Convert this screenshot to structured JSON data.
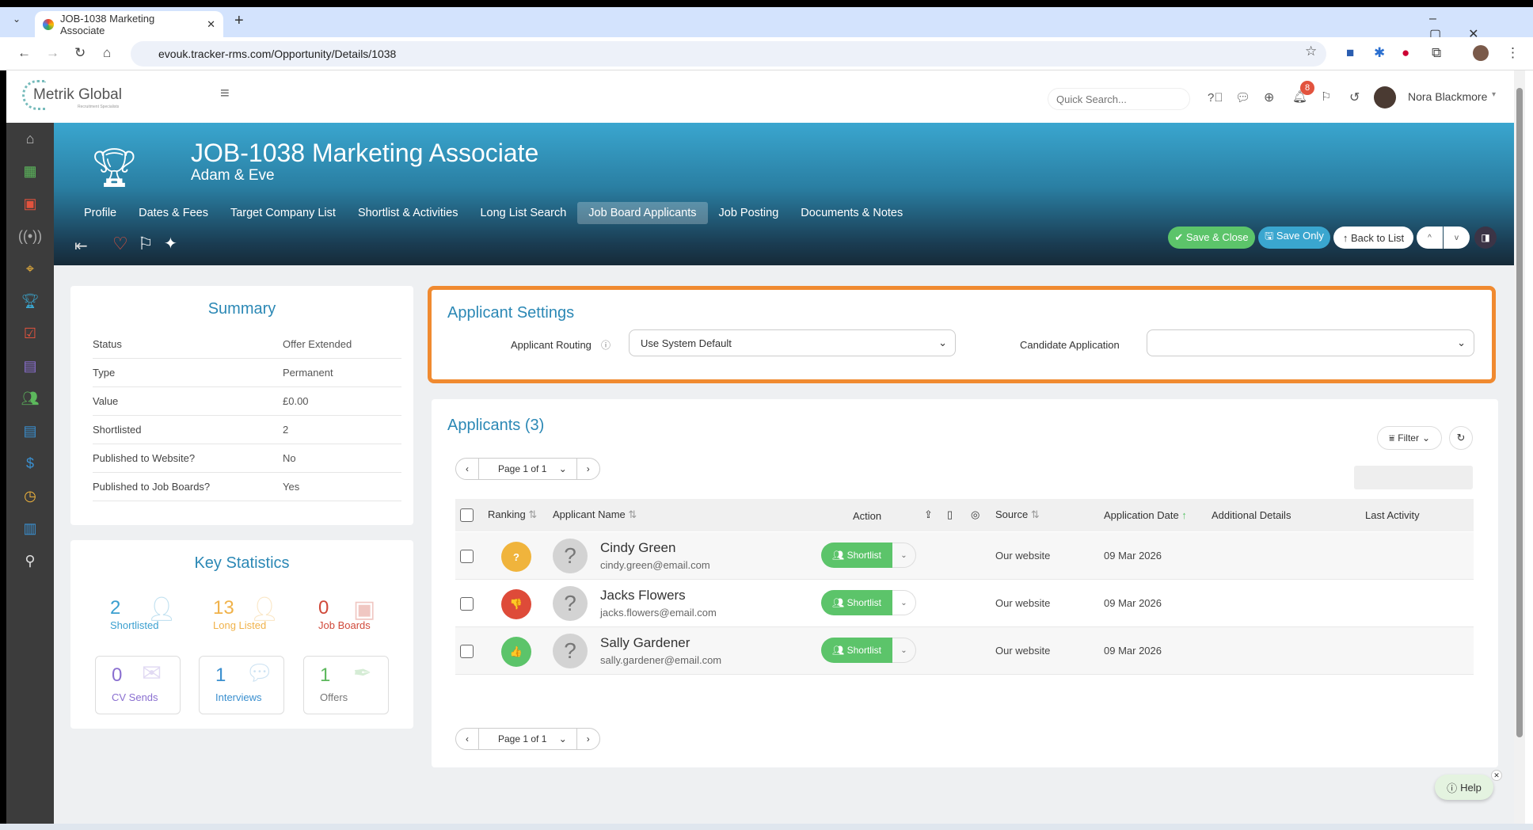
{
  "browser": {
    "tab_title": "JOB-1038 Marketing Associate",
    "url": "evouk.tracker-rms.com/Opportunity/Details/1038"
  },
  "header": {
    "logo_text": "Metrik Global",
    "logo_sub": "Recruitment Specialists",
    "search_placeholder": "Quick Search...",
    "notif_count": "8",
    "user_name": "Nora Blackmore"
  },
  "banner": {
    "title": "JOB-1038 Marketing Associate",
    "subtitle": "Adam & Eve",
    "tabs": [
      "Profile",
      "Dates & Fees",
      "Target Company List",
      "Shortlist & Activities",
      "Long List Search",
      "Job Board Applicants",
      "Job Posting",
      "Documents & Notes"
    ],
    "active_tab": "Job Board Applicants",
    "buttons": {
      "save_close": "✔ Save & Close",
      "save_only": "🖫 Save Only",
      "back": "↑ Back to List"
    }
  },
  "summary": {
    "title": "Summary",
    "rows": [
      [
        "Status",
        "Offer Extended"
      ],
      [
        "Type",
        "Permanent"
      ],
      [
        "Value",
        "£0.00"
      ],
      [
        "Shortlisted",
        "2"
      ],
      [
        "Published to Website?",
        "No"
      ],
      [
        "Published to Job Boards?",
        "Yes"
      ]
    ]
  },
  "stats": {
    "title": "Key Statistics",
    "items": [
      {
        "n": "2",
        "l": "Shortlisted",
        "c": "#3a9fcb"
      },
      {
        "n": "13",
        "l": "Long Listed",
        "c": "#f0b24a"
      },
      {
        "n": "0",
        "l": "Job Boards",
        "c": "#d0493a"
      },
      {
        "n": "0",
        "l": "CV Sends",
        "c": "#8a6fd0"
      },
      {
        "n": "1",
        "l": "Interviews",
        "c": "#3a8fcf"
      },
      {
        "n": "1",
        "l": "Offers",
        "c": "#5cb85c"
      }
    ]
  },
  "settings": {
    "title": "Applicant Settings",
    "routing_label": "Applicant Routing",
    "routing_value": "Use System Default",
    "candidate_label": "Candidate Application",
    "candidate_value": ""
  },
  "applicants": {
    "title": "Applicants (3)",
    "filter": "Filter",
    "page": "Page 1 of 1",
    "columns": [
      "Ranking",
      "Applicant Name",
      "Action",
      "Source",
      "Application Date",
      "Additional Details",
      "Last Activity"
    ],
    "rows": [
      {
        "rank": "?",
        "rank_color": "#f0b43c",
        "name": "Cindy Green",
        "email": "cindy.green@email.com",
        "action": "Shortlist",
        "source": "Our website",
        "date": "09 Mar 2026"
      },
      {
        "rank": "👎",
        "rank_color": "#de4b39",
        "name": "Jacks Flowers",
        "email": "jacks.flowers@email.com",
        "action": "Shortlist",
        "source": "Our website",
        "date": "09 Mar 2026"
      },
      {
        "rank": "👍",
        "rank_color": "#5cc46a",
        "name": "Sally Gardener",
        "email": "sally.gardener@email.com",
        "action": "Shortlist",
        "source": "Our website",
        "date": "09 Mar 2026"
      }
    ]
  },
  "help": "Help"
}
